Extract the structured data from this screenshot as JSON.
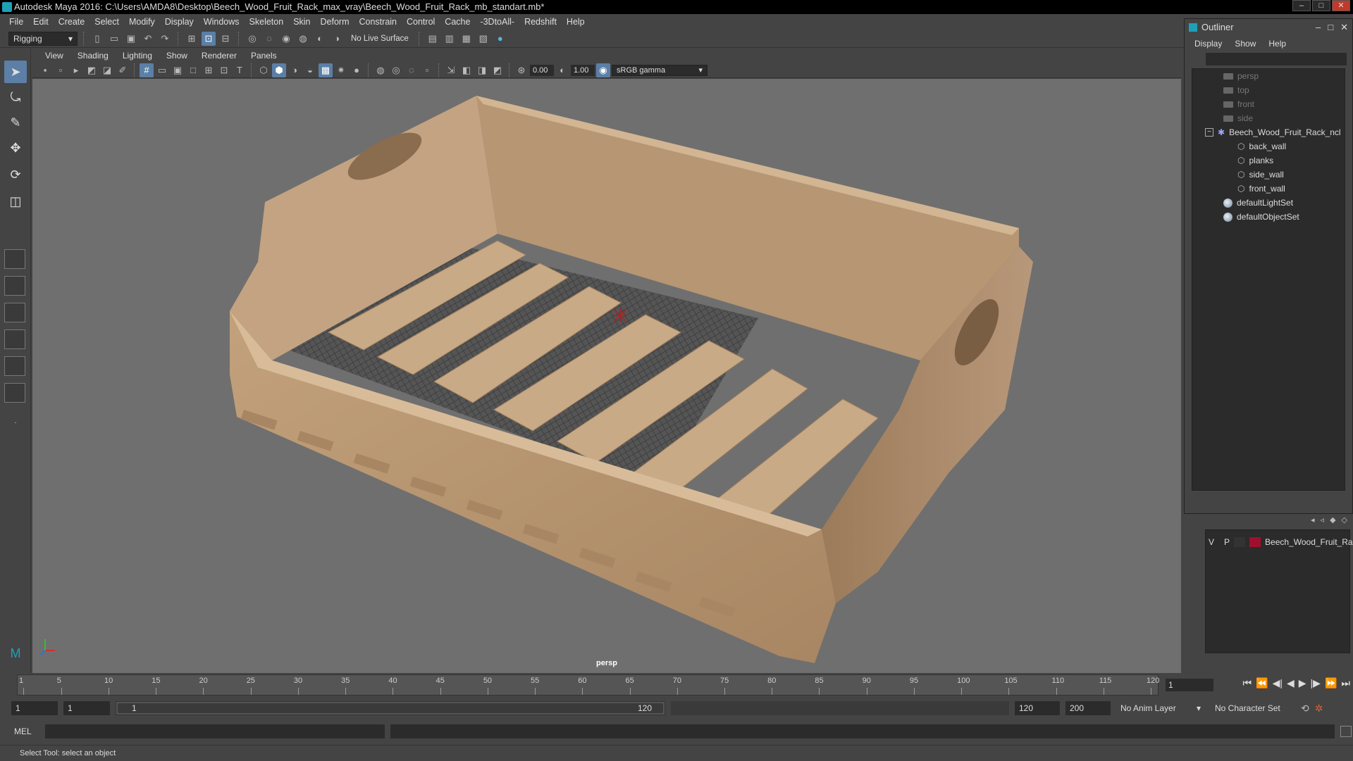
{
  "window": {
    "title": "Autodesk Maya 2016: C:\\Users\\AMDA8\\Desktop\\Beech_Wood_Fruit_Rack_max_vray\\Beech_Wood_Fruit_Rack_mb_standart.mb*",
    "minimize": "–",
    "maximize": "□",
    "close": "✕"
  },
  "menubar": [
    "File",
    "Edit",
    "Create",
    "Select",
    "Modify",
    "Display",
    "Windows",
    "Skeleton",
    "Skin",
    "Deform",
    "Constrain",
    "Control",
    "Cache",
    "-3DtoAll-",
    "Redshift",
    "Help"
  ],
  "statusline": {
    "mode": "Rigging",
    "live_surface": "No Live Surface"
  },
  "panel": {
    "menus": [
      "View",
      "Shading",
      "Lighting",
      "Show",
      "Renderer",
      "Panels"
    ],
    "exposure": "0.00",
    "gamma": "1.00",
    "color_space": "sRGB gamma",
    "camera_label": "persp"
  },
  "outliner": {
    "title": "Outliner",
    "minimize": "–",
    "maximize": "□",
    "close": "✕",
    "menus": [
      "Display",
      "Show",
      "Help"
    ],
    "items": [
      {
        "label": "persp",
        "type": "camera",
        "dim": true
      },
      {
        "label": "top",
        "type": "camera",
        "dim": true
      },
      {
        "label": "front",
        "type": "camera",
        "dim": true
      },
      {
        "label": "side",
        "type": "camera",
        "dim": true
      },
      {
        "label": "Beech_Wood_Fruit_Rack_ncl",
        "type": "group",
        "dim": false
      },
      {
        "label": "back_wall",
        "type": "mesh",
        "dim": false
      },
      {
        "label": "planks",
        "type": "mesh",
        "dim": false
      },
      {
        "label": "side_wall",
        "type": "mesh",
        "dim": false
      },
      {
        "label": "front_wall",
        "type": "mesh",
        "dim": false
      },
      {
        "label": "defaultLightSet",
        "type": "set",
        "dim": false
      },
      {
        "label": "defaultObjectSet",
        "type": "set",
        "dim": false
      }
    ]
  },
  "layers": {
    "v": "V",
    "p": "P",
    "name": "Beech_Wood_Fruit_Ra",
    "color": "#a0102c"
  },
  "timeline": {
    "ticks": [
      "1",
      "5",
      "10",
      "15",
      "20",
      "25",
      "30",
      "35",
      "40",
      "45",
      "50",
      "55",
      "60",
      "65",
      "70",
      "75",
      "80",
      "85",
      "90",
      "95",
      "100",
      "105",
      "110",
      "115",
      "120"
    ],
    "current_frame": "1"
  },
  "range": {
    "start": "1",
    "start2": "1",
    "slider_start": "1",
    "slider_end": "120",
    "end": "120",
    "end2": "200",
    "anim_layer": "No Anim Layer",
    "char_set": "No Character Set"
  },
  "cmdline": {
    "lang": "MEL"
  },
  "helpline": "Select Tool: select an object"
}
